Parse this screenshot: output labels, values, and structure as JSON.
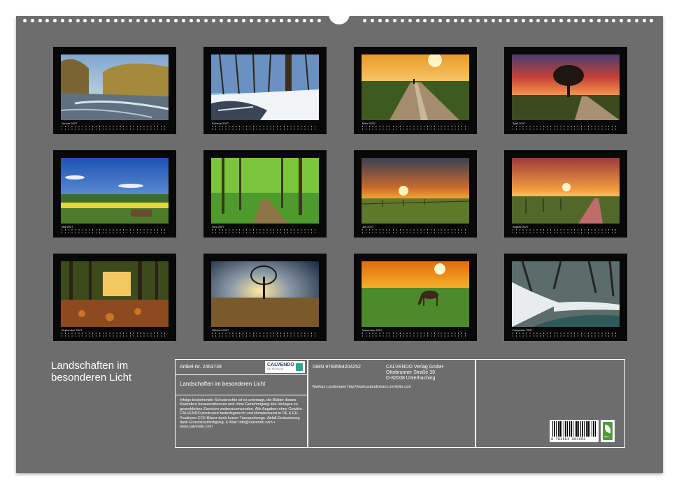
{
  "product": {
    "title": "Landschaften im besonderen Licht",
    "article_label": "Artikel-Nr. 2463739",
    "isbn_label": "ISBN 9783594204252",
    "calendar_title": "Landschaften im besonderen Licht",
    "author_line": "Markus Landsmann http://markuslandsmann.zenfolio.com",
    "barcode_number": "9 783594 204252"
  },
  "brand": {
    "logo_text": "CALVENDO",
    "logo_subtext": "Seite, Buch Kalender",
    "accent_color": "#2ea58c"
  },
  "publisher": {
    "name": "CALVENDO Verlag GmbH",
    "street": "Ottobrunner Straße 39",
    "city": "D-82008 Unterhaching"
  },
  "legal_text": "Infolge bestehender Schutzrechte ist es untersagt, die Blätter dieses Kalenders herauszutrennen und ohne Genehmigung des Verlages zu gewerblichen Zwecken weiterzuverwenden. Alle Angaben ohne Gewähr. CALVENDO produziert bedarfsgerecht und klimabewusst in DE & EU. Positivere CO2-Bilanz dank kurzer Transportwege. Abfall-Reduzierung dank Einzelstückfertigung. E-Mail: info@calvendo.com • www.calvendo.com",
  "eco_label": "eco",
  "months": [
    {
      "label": "Januar 2027",
      "scene": "river-winter"
    },
    {
      "label": "Februar 2027",
      "scene": "snow-forest"
    },
    {
      "label": "März 2027",
      "scene": "sunset-path"
    },
    {
      "label": "April 2027",
      "scene": "red-sky-tree"
    },
    {
      "label": "Mai 2027",
      "scene": "rapeseed-fields"
    },
    {
      "label": "Juni 2027",
      "scene": "green-forest"
    },
    {
      "label": "Juli 2027",
      "scene": "sunset-pasture"
    },
    {
      "label": "August 2027",
      "scene": "sunset-road"
    },
    {
      "label": "September 2027",
      "scene": "autumn-forest"
    },
    {
      "label": "Oktober 2027",
      "scene": "tree-field"
    },
    {
      "label": "November 2027",
      "scene": "horse-sunset"
    },
    {
      "label": "Dezember 2027",
      "scene": "snow-stream"
    }
  ]
}
